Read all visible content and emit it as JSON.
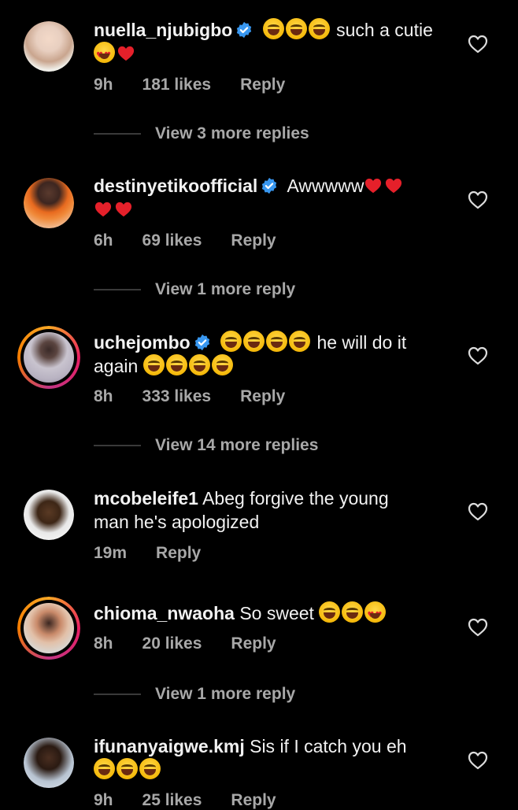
{
  "comments": [
    {
      "username": "nuella_njubigbo",
      "verified": true,
      "text": "such a cutie",
      "time": "9h",
      "likes": "181 likes",
      "reply": "Reply",
      "view_more": "View 3 more replies"
    },
    {
      "username": "destinyetikoofficial",
      "verified": true,
      "text": "Awwwww",
      "time": "6h",
      "likes": "69 likes",
      "reply": "Reply",
      "view_more": "View 1 more reply"
    },
    {
      "username": "uchejombo",
      "verified": true,
      "text": "he will do it again",
      "text_part1": "he will do it",
      "text_part2": "again",
      "time": "8h",
      "likes": "333 likes",
      "reply": "Reply",
      "view_more": "View 14 more replies"
    },
    {
      "username": "mcobeleife1",
      "verified": false,
      "text": "Abeg forgive the young man he's apologized",
      "text_part1": "Abeg forgive the young",
      "text_part2": "man he's apologized",
      "time": "19m",
      "reply": "Reply"
    },
    {
      "username": "chioma_nwaoha",
      "verified": false,
      "text": "So sweet",
      "time": "8h",
      "likes": "20 likes",
      "reply": "Reply",
      "view_more": "View 1 more reply"
    },
    {
      "username": "ifunanyaigwe.kmj",
      "verified": false,
      "text": "Sis if I catch you eh",
      "time": "9h",
      "likes": "25 likes",
      "reply": "Reply"
    }
  ],
  "icons": {
    "verified": "verified-badge-icon",
    "like": "heart-outline-icon"
  },
  "colors": {
    "background": "#000000",
    "verified_blue": "#3897f0",
    "meta_gray": "#a8a8a8"
  }
}
